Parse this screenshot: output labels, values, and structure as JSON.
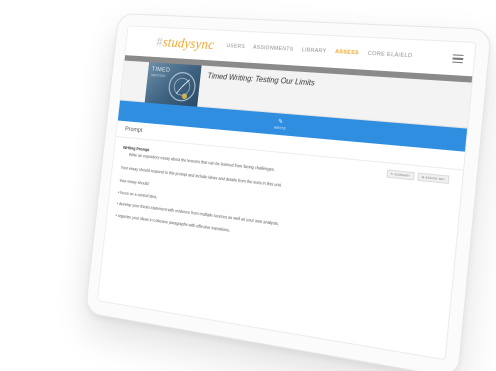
{
  "app": {
    "logo_hash": "#",
    "logo_text": "studysync"
  },
  "nav": {
    "items": [
      "USERS",
      "ASSIGNMENTS",
      "LIBRARY",
      "ASSESS",
      "CORE ELA/ELD"
    ],
    "active": "ASSESS"
  },
  "assignment": {
    "thumb_title": "TIMED",
    "thumb_subtitle": "WRITING",
    "title": "Timed Writing: Testing Our Limits"
  },
  "actionbar": {
    "icon": "pencil-icon",
    "label": "WRITE"
  },
  "prompt": {
    "section_title": "Prompt",
    "label": "Writing Prompt",
    "buttons": [
      "✎ SUMMARY",
      "⊕ ASSIGN SET"
    ],
    "intro": "Write an expository essay about the lessons that can be learned from facing challenges.",
    "instruction": "Your essay should respond to this prompt and include ideas and details from the texts in this unit.",
    "list_intro": "Your essay should:",
    "bullets": [
      "focus on a central idea,",
      "develop your thesis statement with evidence from multiple sources as well as your own analysis,",
      "organize your ideas in cohesive paragraphs with effective transitions,"
    ]
  },
  "colors": {
    "brand_orange": "#f2a62a",
    "action_blue": "#2f8ee0",
    "nav_grey": "#8a8a8a"
  }
}
